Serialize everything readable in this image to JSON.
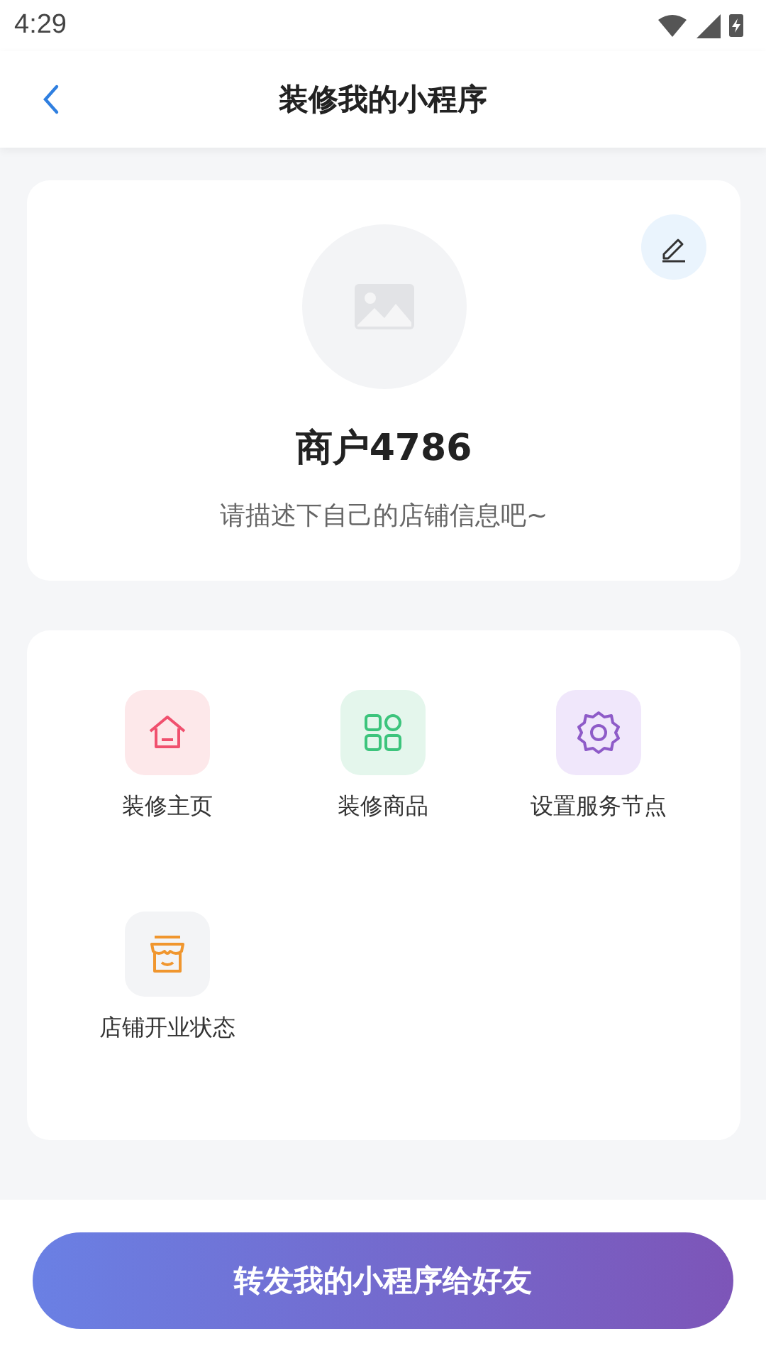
{
  "status_bar": {
    "time": "4:29"
  },
  "header": {
    "title": "装修我的小程序"
  },
  "profile": {
    "name": "商户4786",
    "description": "请描述下自己的店铺信息吧~"
  },
  "menu": [
    {
      "kind": "home",
      "label": "装修主页",
      "color": "#f0506e"
    },
    {
      "kind": "grid",
      "label": "装修商品",
      "color": "#3cc47c"
    },
    {
      "kind": "gear",
      "label": "设置服务节点",
      "color": "#8e5bc8"
    },
    {
      "kind": "store",
      "label": "店铺开业状态",
      "color": "#f0962e"
    }
  ],
  "footer": {
    "button": "转发我的小程序给好友"
  }
}
